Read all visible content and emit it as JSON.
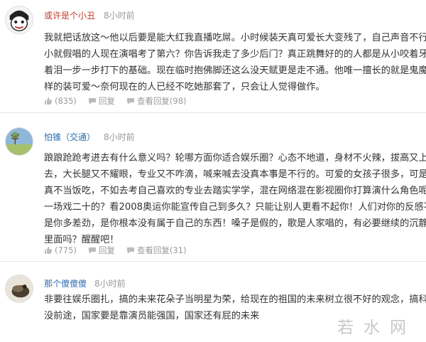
{
  "comments": [
    {
      "user": "或许是个小丑",
      "time": "8小时前",
      "lines": [
        "我就把话放这～他以后要是能大红我直播吃屌。小时候装天真可爱长大变残了，自己声音不行从",
        "小就假唱的人现在演唱考了第六？你告诉我走了多少后门？真正跳舞好的的人都是从小咬着牙流",
        "着泪一步一步打下的基础。现在临时抱佛脚还这么没天赋更是走不通。他唯一擅长的就是鬼魔鬼",
        "样的装可爱～奈何现在的人已经不吃她那套了，只会让人觉得做作。"
      ],
      "likes": "(835)",
      "reply_label": "回复",
      "view_replies": "查看回复(98)"
    },
    {
      "user": "怕锥（交通）",
      "time": "8小时前",
      "lines": [
        "踉踉跄跄考进去有什么意义吗？轮哪方面你适合娱乐圈？心态不地道，身材不火辣，拔高又上不",
        "去，大长腿又不耀眼，专业又不咋滴，喊来喊去没真本事是不行的。可爱的女孩子很多，可是它",
        "真不当饭吃，不如去考自己喜欢的专业去踏实学学，混在网络混在影视圈你打算演什么角色呢？",
        "一场戏二十的？看2008奥运你能宣传自己到多久？只能让别人更看不起你！人们对你的反感不",
        "是你多差劲，是你根本没有属于自己的东西！嗓子是假的，歌是人家唱的，有必要继续的沉静在",
        "里面吗？醒醒吧！"
      ],
      "likes": "(775)",
      "reply_label": "回复",
      "view_replies": "查看回复(31)"
    },
    {
      "user": "那个傻傻傻",
      "time": "8小时前",
      "lines": [
        "非要往娱乐圈扎，搞的未来花朵子当明星为荣，给现在的祖国的未来树立很不好的观念，搞科研",
        "没前途，国家要是靠演员能强国，国家还有屁的未来"
      ]
    }
  ],
  "watermark": "若水网",
  "colors": {
    "username_red": "#c0392b",
    "username_blue": "#2b6cb0",
    "meta": "#999999"
  }
}
